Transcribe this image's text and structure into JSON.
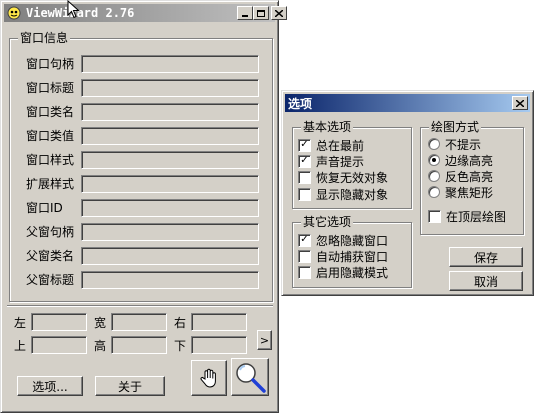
{
  "main_window": {
    "title": "ViewWizard 2.76",
    "window_info_group": "窗口信息",
    "fields": [
      "窗口句柄",
      "窗口标题",
      "窗口类名",
      "窗口类值",
      "窗口样式",
      "扩展样式",
      "窗口ID",
      "父窗句柄",
      "父窗类名",
      "父窗标题"
    ],
    "coords": {
      "left": "左",
      "width": "宽",
      "right": "右",
      "top": "上",
      "height": "高",
      "bottom": "下"
    },
    "more_arrow": ">",
    "options_button": "选项...",
    "about_button": "关于"
  },
  "options_dialog": {
    "title": "选项",
    "basic_group": "基本选项",
    "basic_items": [
      {
        "label": "总在最前",
        "checked": true
      },
      {
        "label": "声音提示",
        "checked": true
      },
      {
        "label": "恢复无效对象",
        "checked": false
      },
      {
        "label": "显示隐藏对象",
        "checked": false
      }
    ],
    "other_group": "其它选项",
    "other_items": [
      {
        "label": "忽略隐藏窗口",
        "checked": true
      },
      {
        "label": "自动捕获窗口",
        "checked": false
      },
      {
        "label": "启用隐藏模式",
        "checked": false
      }
    ],
    "draw_group": "绘图方式",
    "draw_items": [
      {
        "label": "不提示",
        "selected": false
      },
      {
        "label": "边缘高亮",
        "selected": true
      },
      {
        "label": "反色高亮",
        "selected": false
      },
      {
        "label": "聚焦矩形",
        "selected": false
      }
    ],
    "top_layer_draw": {
      "label": "在顶层绘图",
      "checked": false
    },
    "save_button": "保存",
    "cancel_button": "取消",
    "close_glyph": "×"
  },
  "colors": {
    "title_active_start": "#0a246a",
    "title_active_end": "#a6caf0",
    "title_inactive_start": "#808080",
    "title_inactive_end": "#c0c0c0"
  }
}
